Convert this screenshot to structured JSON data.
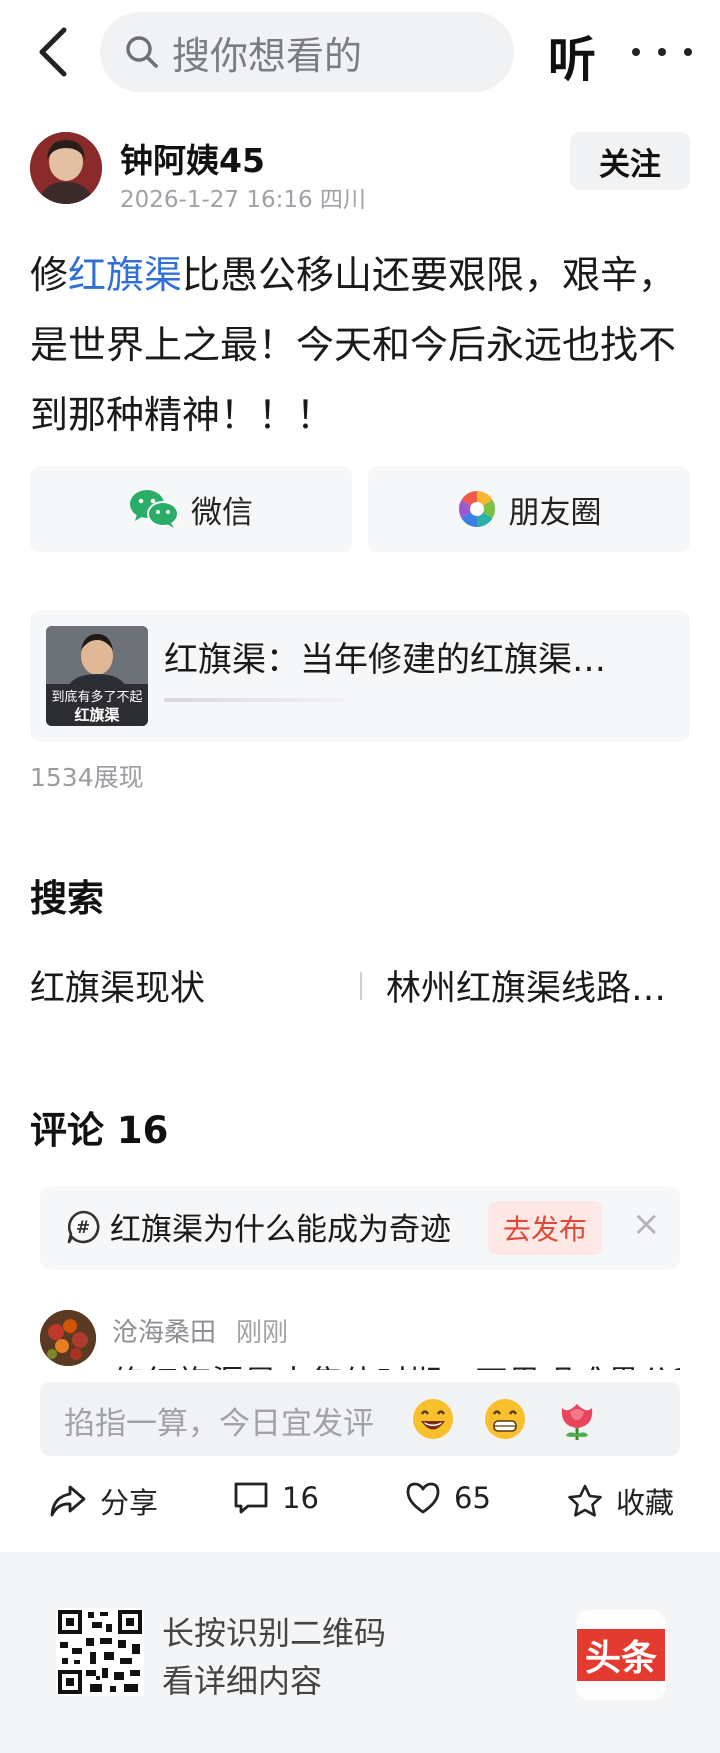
{
  "topbar": {
    "search_placeholder": "搜你想看的",
    "listen_label": "听"
  },
  "author": {
    "name": "钟阿姨45",
    "meta": "2026-1-27 16:16 四川",
    "follow_label": "关注"
  },
  "post": {
    "text_before": "修",
    "link_text": "红旗渠",
    "text_after": "比愚公移山还要艰限，艰辛，是世界上之最！今天和今后永远也找不到那种精神！！！"
  },
  "share": {
    "wechat_label": "微信",
    "moments_label": "朋友圈"
  },
  "article": {
    "title": "红旗渠：当年修建的红旗渠…",
    "thumb_caption_1": "到底有多了不起",
    "thumb_caption_2": "红旗渠"
  },
  "views": "1534展现",
  "search_section": {
    "title": "搜索",
    "items": [
      "红旗渠现状",
      "林州红旗渠线路…"
    ]
  },
  "comments_section": {
    "title": "评论 16"
  },
  "topic": {
    "text": "红旗渠为什么能成为奇迹",
    "publish_label": "去发布",
    "close": "×"
  },
  "comment": {
    "name": "沧海桑田",
    "time": "刚刚",
    "text": "修红旗渠是大集体时期，不畏艰难愚公移山"
  },
  "comment_input": {
    "placeholder": "掐指一算，今日宜发评"
  },
  "actions": {
    "share_label": "分享",
    "comment_count": "16",
    "like_count": "65",
    "favorite_label": "收藏"
  },
  "footer": {
    "line1": "长按识别二维码",
    "line2": "看详细内容",
    "logo_text": "头条"
  },
  "colors": {
    "link": "#2f6fd8",
    "publish": "#e0483a",
    "logo": "#e53a2f"
  }
}
